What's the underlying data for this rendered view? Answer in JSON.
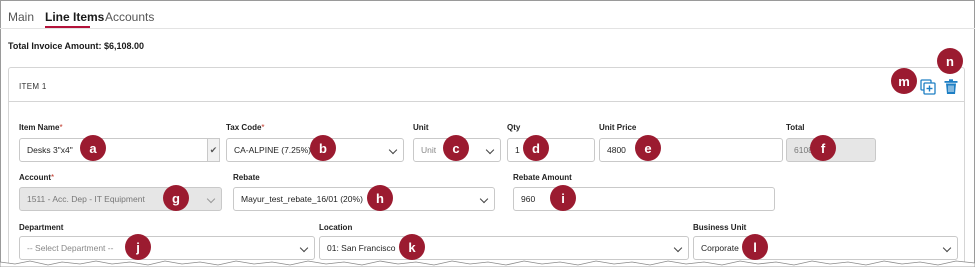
{
  "tabs": [
    {
      "label": "Main",
      "active": false
    },
    {
      "label": "Line Items",
      "active": true
    },
    {
      "label": "Accounts",
      "active": false
    }
  ],
  "total_invoice": "Total Invoice Amount: $6,108.00",
  "item": {
    "title": "ITEM 1",
    "icons": [
      "copy-add-icon",
      "trash-icon"
    ]
  },
  "fields": {
    "item_name": {
      "label": "Item Name",
      "required": "*",
      "value": "Desks 3\"x4\""
    },
    "tax_code": {
      "label": "Tax Code",
      "required": "*",
      "value": "CA-ALPINE (7.25%)"
    },
    "unit": {
      "label": "Unit",
      "placeholder": "Unit"
    },
    "qty": {
      "label": "Qty",
      "value": "1"
    },
    "unit_price": {
      "label": "Unit Price",
      "value": "4800"
    },
    "total": {
      "label": "Total",
      "value": "6108"
    },
    "account": {
      "label": "Account",
      "required": "*",
      "value": "1511 - Acc. Dep - IT Equipment"
    },
    "rebate": {
      "label": "Rebate",
      "value": "Mayur_test_rebate_16/01 (20%)"
    },
    "rebate_amount": {
      "label": "Rebate Amount",
      "value": "960"
    },
    "department": {
      "label": "Department",
      "placeholder": "-- Select Department --"
    },
    "location": {
      "label": "Location",
      "value": "01: San Francisco"
    },
    "business_unit": {
      "label": "Business Unit",
      "value": "Corporate"
    }
  },
  "callouts": {
    "a": "a",
    "b": "b",
    "c": "c",
    "d": "d",
    "e": "e",
    "f": "f",
    "g": "g",
    "h": "h",
    "i": "i",
    "j": "j",
    "k": "k",
    "l": "l",
    "m": "m",
    "n": "n"
  },
  "colors": {
    "accent": "#b3123a",
    "callout": "#9b1b30",
    "icon_blue": "#1e7fc4",
    "required": "#c0392b"
  }
}
